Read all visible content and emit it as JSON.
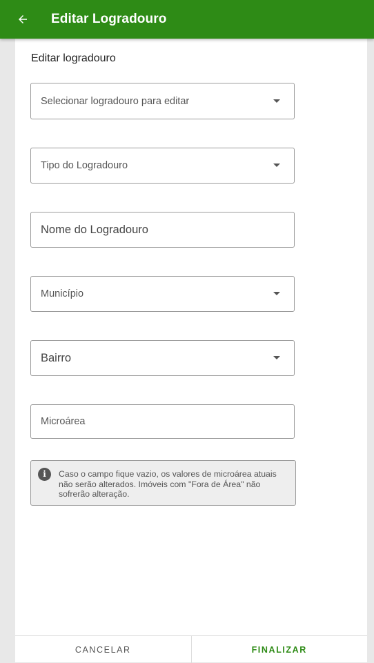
{
  "appbar": {
    "title": "Editar Logradouro",
    "back_icon": "arrow-left-icon",
    "color": "#2e8b16"
  },
  "form": {
    "section_title": "Editar logradouro",
    "select_logradouro": "Selecionar logradouro para editar",
    "tipo_logradouro": "Tipo do Logradouro",
    "nome_logradouro": "Nome do Logradouro",
    "municipio": "Município",
    "bairro": "Bairro",
    "microarea": "Microárea",
    "info_icon": "info-icon",
    "info_text": "Caso o campo fique vazio, os valores de microárea atuais não serão alterados. Imóveis com \"Fora de Área\" não sofrerão alteração."
  },
  "footer": {
    "cancel_label": "CANCELAR",
    "finish_label": "FINALIZAR"
  }
}
